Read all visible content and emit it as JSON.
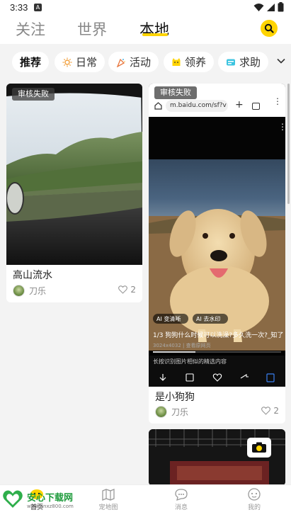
{
  "status_bar": {
    "time": "3:33",
    "notification_badge": "A"
  },
  "top_tabs": [
    {
      "label": "关注",
      "active": false
    },
    {
      "label": "世界",
      "active": false
    },
    {
      "label": "本地",
      "active": true
    }
  ],
  "categories": [
    {
      "label": "推荐",
      "icon": "",
      "active": true
    },
    {
      "label": "日常",
      "icon": "sun-icon",
      "active": false
    },
    {
      "label": "活动",
      "icon": "party-icon",
      "active": false
    },
    {
      "label": "领养",
      "icon": "cat-icon",
      "active": false
    },
    {
      "label": "求助",
      "icon": "help-icon",
      "active": false
    }
  ],
  "feed": [
    {
      "badge": "审核失败",
      "title": "高山流水",
      "author": "刀乐",
      "likes": "2"
    },
    {
      "badge": "审核失败",
      "title": "是小狗狗",
      "author": "刀乐",
      "likes": "2",
      "embedded_url": "m.baidu.com/sf?v",
      "embedded_caption": "1/3 狗狗什么时候可以洗澡?多久洗一次?_知了",
      "embedded_meta": "3024x4032 | 查看原网页",
      "embedded_ai_1": "AI 变清晰",
      "embedded_ai_2": "AI 去水印",
      "embedded_search_hint": "长按识别图片相似的精选内容"
    }
  ],
  "bottom_nav": [
    {
      "label": "首页"
    },
    {
      "label": "宠地图"
    },
    {
      "label": "消息"
    },
    {
      "label": "我的"
    }
  ],
  "watermark": {
    "name": "安心下载网",
    "url": "www.anxz800.com"
  },
  "colors": {
    "accent": "#ffd400",
    "badge_bg": "#3c3c3c"
  }
}
